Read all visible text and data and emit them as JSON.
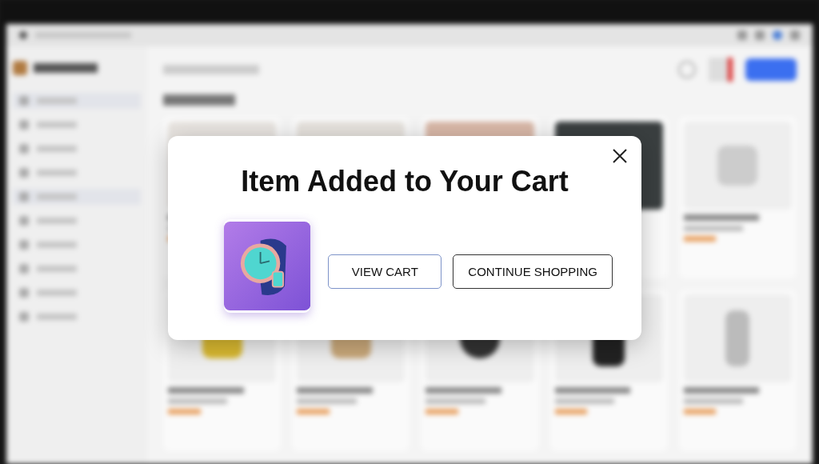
{
  "dialog": {
    "title": "Item Added to Your Cart",
    "buttons": [
      {
        "label": "VIEW CART",
        "kind": "primary"
      },
      {
        "label": "CONTINUE SHOPPING",
        "kind": "secondary"
      }
    ]
  }
}
